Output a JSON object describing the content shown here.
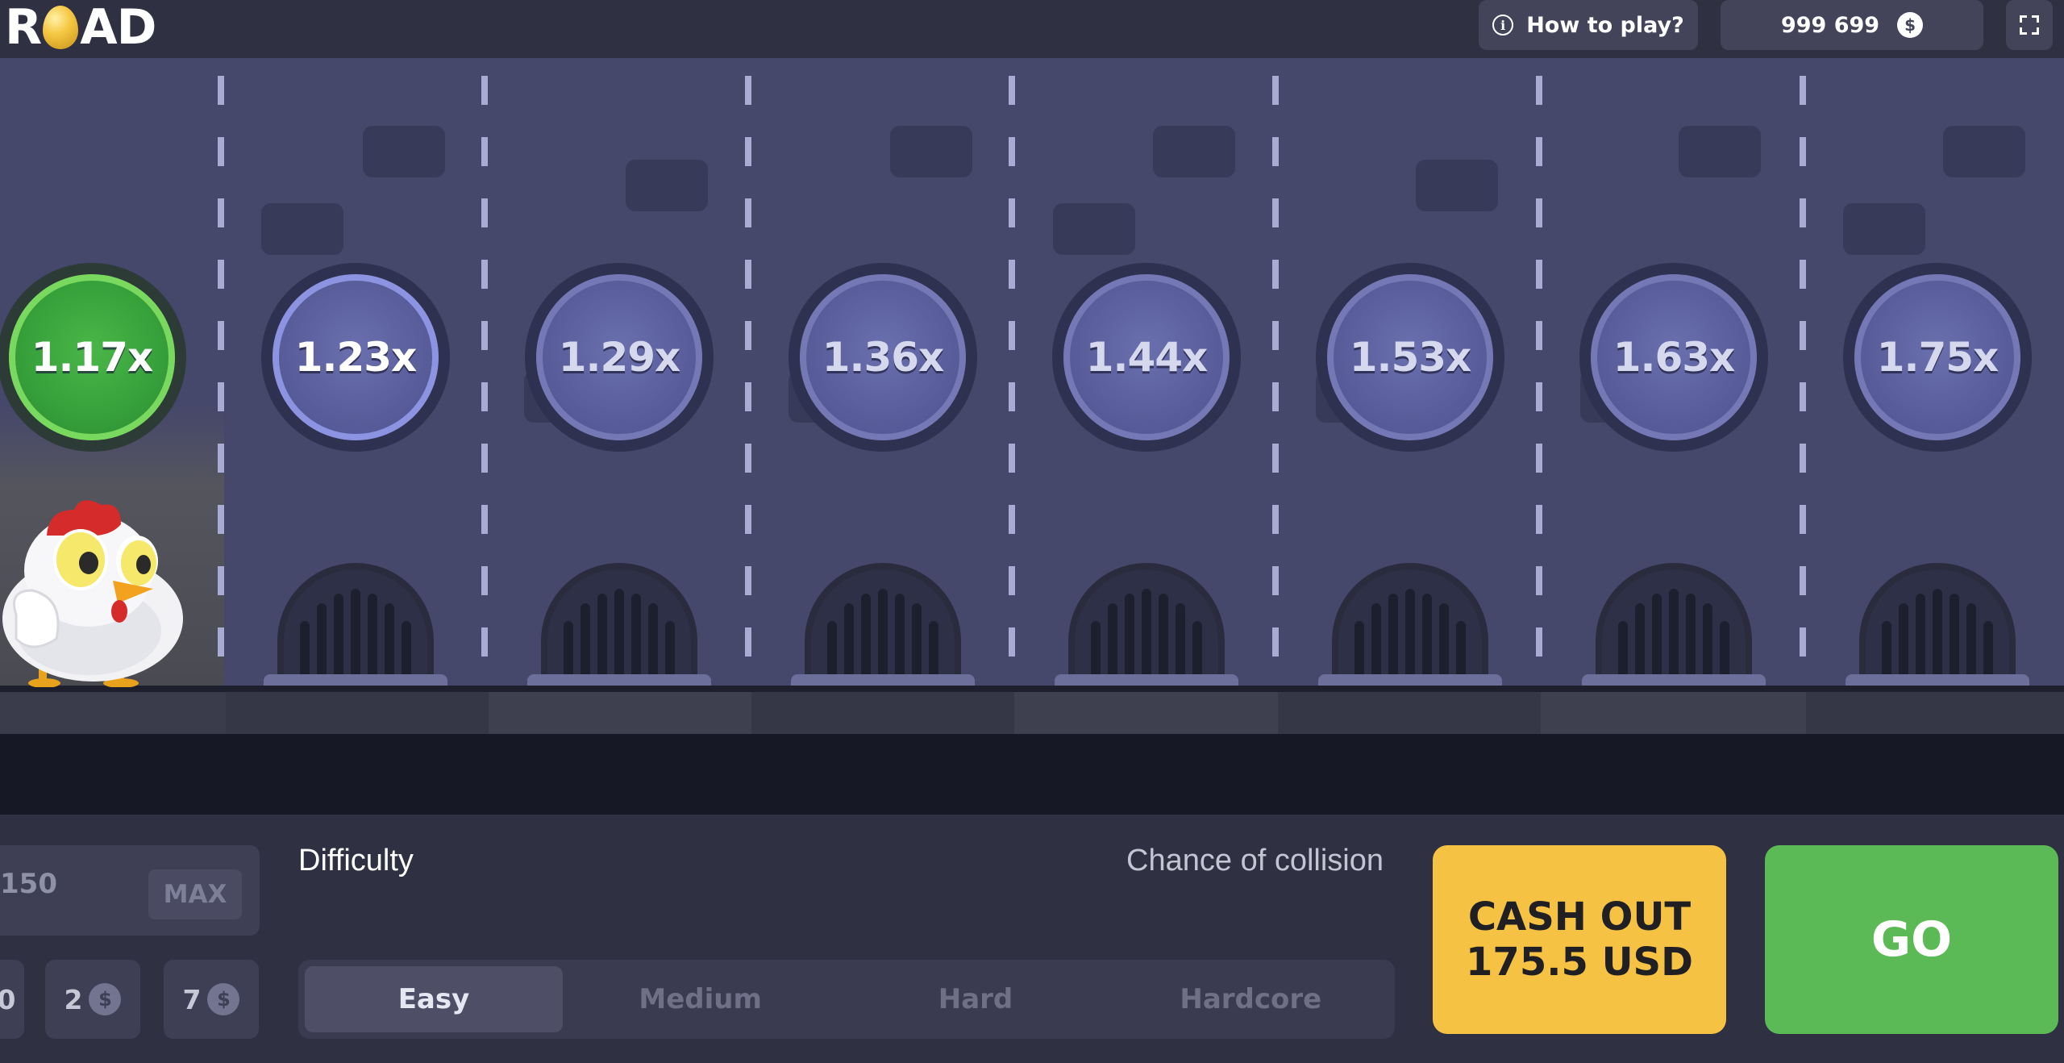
{
  "header": {
    "logo_text_1": "R",
    "logo_text_2": "AD",
    "how_to_play": "How to play?",
    "balance": "999 699",
    "currency_symbol": "$"
  },
  "lanes": {
    "multipliers": [
      "1.17x",
      "1.23x",
      "1.29x",
      "1.36x",
      "1.44x",
      "1.53x",
      "1.63x",
      "1.75x"
    ],
    "active_index": 0
  },
  "controls": {
    "bet_value": "150",
    "max_label": "MAX",
    "chips": [
      "0",
      "2",
      "7"
    ],
    "chip_currency": "$",
    "difficulty_label": "Difficulty",
    "collision_label": "Chance of collision",
    "difficulty_options": [
      "Easy",
      "Medium",
      "Hard",
      "Hardcore"
    ],
    "selected_difficulty": "Easy",
    "cashout_line1": "CASH OUT",
    "cashout_line2": "175.5 USD",
    "go_label": "GO"
  },
  "colors": {
    "accent_green": "#5cba56",
    "cashout_yellow": "#f5c243",
    "lane": "#45476b"
  }
}
